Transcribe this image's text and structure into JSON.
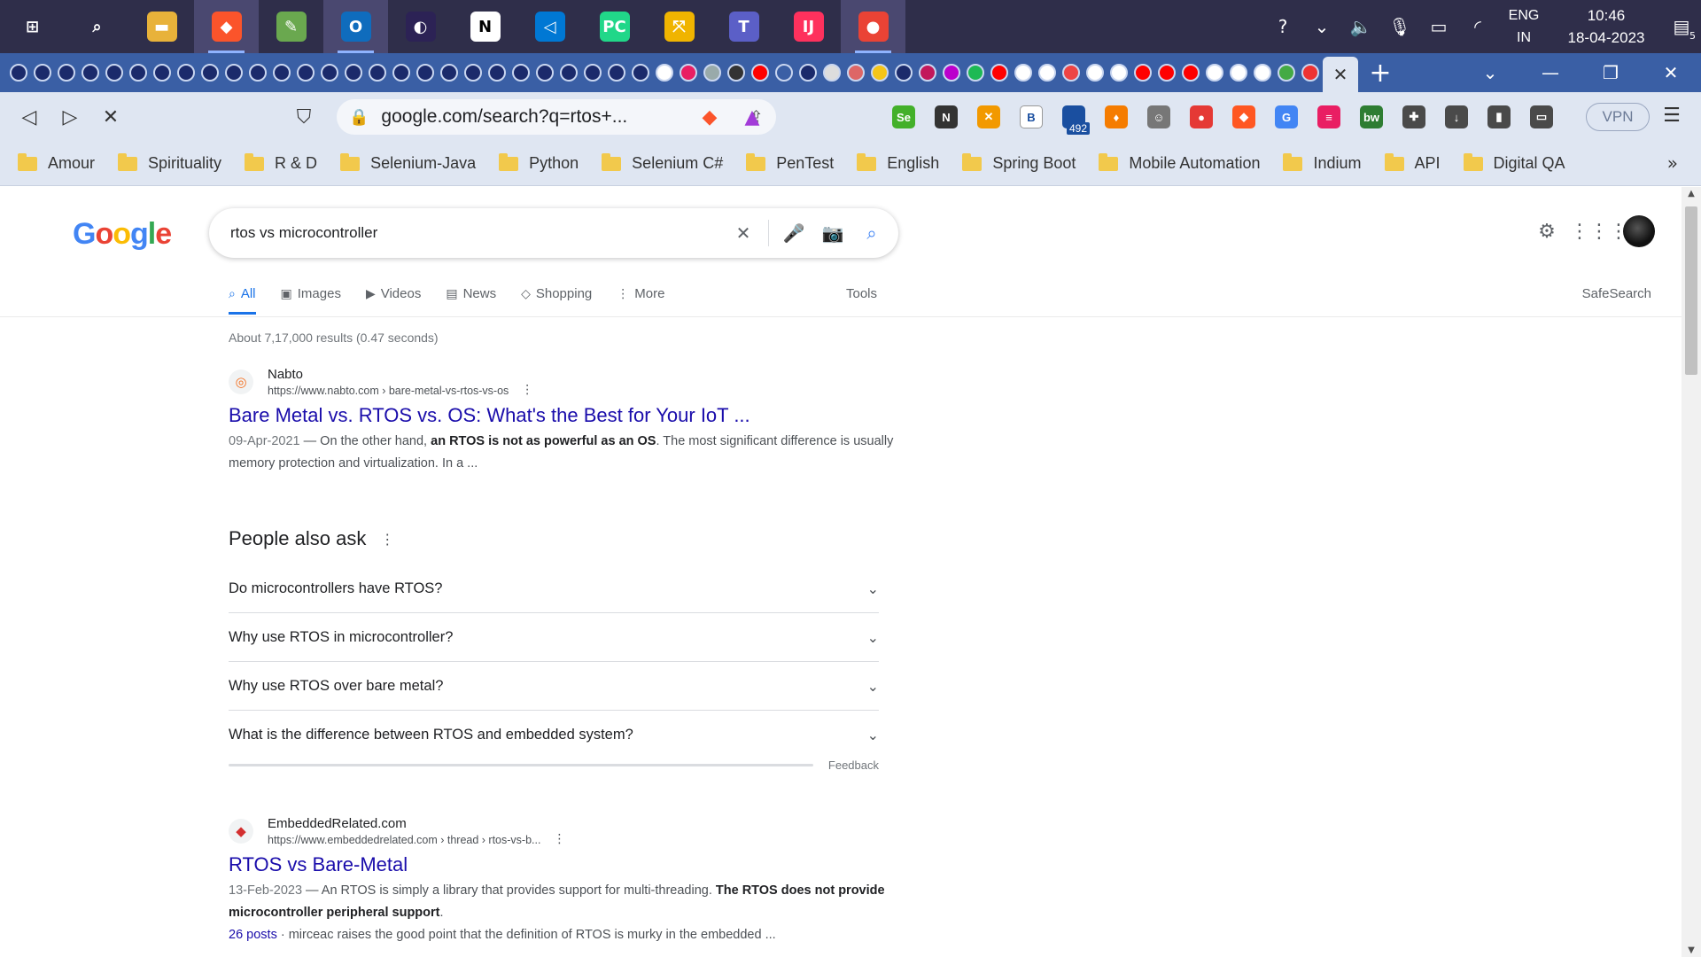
{
  "taskbar": {
    "apps": [
      {
        "name": "start",
        "glyph": "⊞",
        "bg": "transparent"
      },
      {
        "name": "search",
        "glyph": "⌕",
        "bg": "transparent"
      },
      {
        "name": "file-explorer",
        "glyph": "▬",
        "bg": "#e8b23a"
      },
      {
        "name": "brave",
        "glyph": "◆",
        "bg": "#fb542b"
      },
      {
        "name": "notepad",
        "glyph": "✎",
        "bg": "#6aa84f"
      },
      {
        "name": "outlook",
        "glyph": "O",
        "bg": "#0f6cbd"
      },
      {
        "name": "eclipse",
        "glyph": "◐",
        "bg": "#2c2255"
      },
      {
        "name": "notion",
        "glyph": "N",
        "bg": "#ffffff"
      },
      {
        "name": "vscode",
        "glyph": "◁",
        "bg": "#0078d4"
      },
      {
        "name": "pycharm",
        "glyph": "PC",
        "bg": "#21d789"
      },
      {
        "name": "network-tool",
        "glyph": "⤧",
        "bg": "#f0b400"
      },
      {
        "name": "teams",
        "glyph": "T",
        "bg": "#5b5fc7"
      },
      {
        "name": "intellij",
        "glyph": "IJ",
        "bg": "#fe315d"
      },
      {
        "name": "chrome",
        "glyph": "●",
        "bg": "#ea4335"
      }
    ],
    "tray": {
      "lang_line1": "ENG",
      "lang_line2": "IN",
      "time": "10:46",
      "date": "18-04-2023",
      "notification_count": "5"
    }
  },
  "tabstrip": {
    "favicons": [
      "#1b2a6b",
      "#1b2a6b",
      "#1b2a6b",
      "#1b2a6b",
      "#1b2a6b",
      "#1b2a6b",
      "#1b2a6b",
      "#1b2a6b",
      "#1b2a6b",
      "#1b2a6b",
      "#1b2a6b",
      "#1b2a6b",
      "#1b2a6b",
      "#1b2a6b",
      "#1b2a6b",
      "#1b2a6b",
      "#1b2a6b",
      "#1b2a6b",
      "#1b2a6b",
      "#1b2a6b",
      "#1b2a6b",
      "#1b2a6b",
      "#1b2a6b",
      "#1b2a6b",
      "#1b2a6b",
      "#1b2a6b",
      "#1b2a6b",
      "#ffffff",
      "#e91e63",
      "#9aa",
      "#333",
      "#ff0000",
      "#3a5fa5",
      "#1b2a6b",
      "#ddd",
      "#d66",
      "#f5c518",
      "#1b2a6b",
      "#c2185b",
      "#b0c",
      "#1db954",
      "#ff0000",
      "#ffffff",
      "#ffffff",
      "#e44",
      "#ffffff",
      "#ffffff",
      "#ff0000",
      "#ff0000",
      "#ff0000",
      "#ffffff",
      "#ffffff",
      "#ffffff",
      "#4a4",
      "#e33"
    ],
    "new_tab": "+"
  },
  "toolbar": {
    "url": "google.com/search?q=rtos+...",
    "vpn_label": "VPN",
    "extension_badge": "492",
    "extensions": [
      {
        "name": "selenium-ide",
        "label": "Se",
        "bg": "#43b02a"
      },
      {
        "name": "notion-clipper",
        "label": "N",
        "bg": "#333333"
      },
      {
        "name": "xpath-helper",
        "label": "✕",
        "bg": "#f29900"
      },
      {
        "name": "bold-ext",
        "label": "B",
        "bg": "#ffffff"
      },
      {
        "name": "counter-ext",
        "label": "",
        "bg": "#1a4fa0"
      },
      {
        "name": "orange-ext",
        "label": "♦",
        "bg": "#f57c00"
      },
      {
        "name": "robot-ext",
        "label": "☺",
        "bg": "#777777"
      },
      {
        "name": "red-ext",
        "label": "●",
        "bg": "#e53935"
      },
      {
        "name": "shield-ext",
        "label": "◆",
        "bg": "#ff5722"
      },
      {
        "name": "translate-ext",
        "label": "G",
        "bg": "#4285f4"
      },
      {
        "name": "flag-ext",
        "label": "≡",
        "bg": "#e91e63"
      },
      {
        "name": "bw-ext",
        "label": "bw",
        "bg": "#2e7d32"
      },
      {
        "name": "puzzle-ext",
        "label": "✚",
        "bg": "#4a4a4a"
      },
      {
        "name": "download",
        "label": "↓",
        "bg": "#4a4a4a"
      },
      {
        "name": "sidebar",
        "label": "▮",
        "bg": "#4a4a4a"
      },
      {
        "name": "wallet",
        "label": "▭",
        "bg": "#4a4a4a"
      }
    ]
  },
  "bookmarks": [
    "Amour",
    "Spirituality",
    "R & D",
    "Selenium-Java",
    "Python",
    "Selenium C#",
    "PenTest",
    "English",
    "Spring Boot",
    "Mobile Automation",
    "Indium",
    "API",
    "Digital QA"
  ],
  "google": {
    "logo": [
      {
        "ch": "G",
        "color": "#4285f4"
      },
      {
        "ch": "o",
        "color": "#ea4335"
      },
      {
        "ch": "o",
        "color": "#fbbc05"
      },
      {
        "ch": "g",
        "color": "#4285f4"
      },
      {
        "ch": "l",
        "color": "#34a853"
      },
      {
        "ch": "e",
        "color": "#ea4335"
      }
    ],
    "query": "rtos vs microcontroller",
    "tabs": [
      {
        "label": "All",
        "icon": "⌕",
        "active": true
      },
      {
        "label": "Images",
        "icon": "▣",
        "active": false
      },
      {
        "label": "Videos",
        "icon": "▶",
        "active": false
      },
      {
        "label": "News",
        "icon": "▤",
        "active": false
      },
      {
        "label": "Shopping",
        "icon": "◇",
        "active": false
      },
      {
        "label": "More",
        "icon": "⋮",
        "active": false
      }
    ],
    "tools_label": "Tools",
    "safesearch_label": "SafeSearch",
    "stats": "About 7,17,000 results (0.47 seconds)",
    "result1": {
      "site": "Nabto",
      "url": "https://www.nabto.com › bare-metal-vs-rtos-vs-os",
      "title": "Bare Metal vs. RTOS vs. OS: What's the Best for Your IoT ...",
      "date": "09-Apr-2021",
      "s1": " — On the other hand, ",
      "s1b": "an RTOS is not as powerful as an OS",
      "s2": ". The most significant difference is usually memory protection and virtualization. In a ..."
    },
    "paa": {
      "title": "People also ask",
      "questions": [
        "Do microcontrollers have RTOS?",
        "Why use RTOS in microcontroller?",
        "Why use RTOS over bare metal?",
        "What is the difference between RTOS and embedded system?"
      ],
      "feedback": "Feedback"
    },
    "result2": {
      "site": "EmbeddedRelated.com",
      "url": "https://www.embeddedrelated.com › thread › rtos-vs-b...",
      "title": "RTOS vs Bare-Metal",
      "date": "13-Feb-2023",
      "s1": " — An RTOS is simply a library that provides support for multi-threading. ",
      "s1b": "The RTOS does not provide microcontroller peripheral support",
      "s2": ".",
      "posts": "26 posts",
      "s3": " · mirceac raises the good point that the definition of RTOS is murky in the embedded ..."
    }
  }
}
